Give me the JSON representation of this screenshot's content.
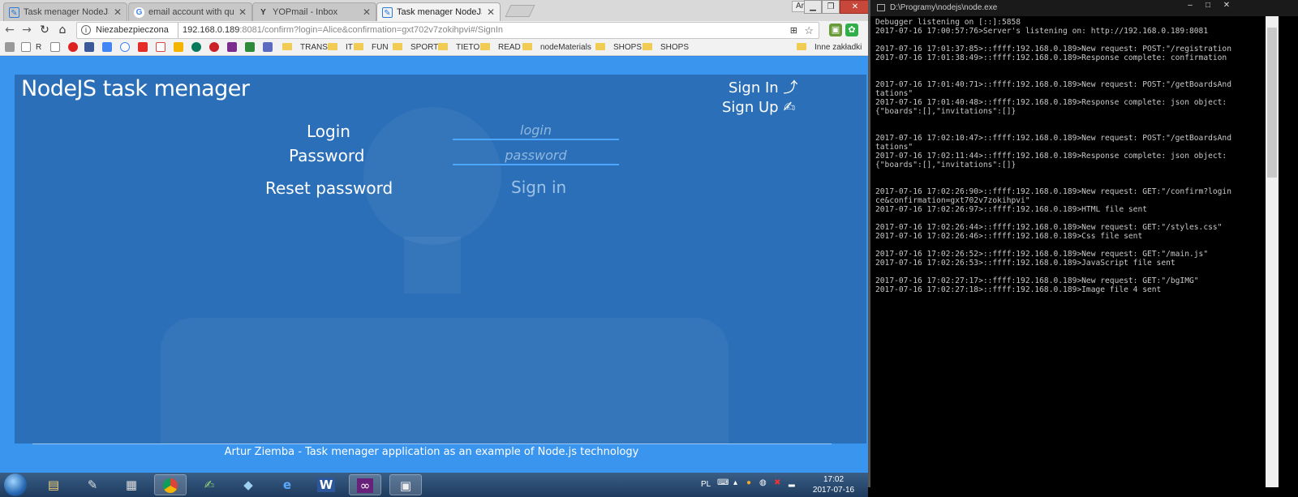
{
  "browser": {
    "tabs": [
      {
        "label": "Task menager NodeJS",
        "favicon": "task-icon",
        "active": false
      },
      {
        "label": "email account with quick",
        "favicon": "google-icon",
        "active": false
      },
      {
        "label": "YOPmail - Inbox",
        "favicon": "yopmail-icon",
        "active": false
      },
      {
        "label": "Task menager NodeJS",
        "favicon": "task-icon",
        "active": true
      }
    ],
    "user_chip": "Artur",
    "omnibox": {
      "security": "Niezabezpieczona",
      "host": "192.168.0.189",
      "path": ":8081/confirm?login=Alice&confirmation=gxt702v7zokihpvi#/SignIn"
    },
    "bookmarks": {
      "short": [
        "R"
      ],
      "folders": [
        "TRANS",
        "IT",
        "FUN",
        "SPORT",
        "TIETO",
        "READ",
        "nodeMaterials",
        "SHOPS",
        "SHOPS"
      ],
      "other": "Inne zakładki"
    }
  },
  "app": {
    "title": "NodeJS task menager",
    "nav": {
      "signin": "Sign In",
      "signup": "Sign Up"
    },
    "form": {
      "login_label": "Login",
      "login_placeholder": "login",
      "password_label": "Password",
      "password_placeholder": "password",
      "reset_label": "Reset password",
      "signin_button": "Sign in"
    },
    "footer": "Artur Ziemba - Task menager application as an example of Node.js technology"
  },
  "console": {
    "title": "D:\\Programy\\nodejs\\node.exe",
    "lines": [
      "Debugger listening on [::]:5858",
      "2017-07-16 17:00:57:76>Server's listening on: http://192.168.0.189:8081",
      "",
      "2017-07-16 17:01:37:85>::ffff:192.168.0.189>New request: POST:\"/registration",
      "2017-07-16 17:01:38:49>::ffff:192.168.0.189>Response complete: confirmation",
      "",
      "",
      "2017-07-16 17:01:40:71>::ffff:192.168.0.189>New request: POST:\"/getBoardsAnd",
      "tations\"",
      "2017-07-16 17:01:40:48>::ffff:192.168.0.189>Response complete: json object:",
      "{\"boards\":[],\"invitations\":[]}",
      "",
      "",
      "2017-07-16 17:02:10:47>::ffff:192.168.0.189>New request: POST:\"/getBoardsAnd",
      "tations\"",
      "2017-07-16 17:02:11:44>::ffff:192.168.0.189>Response complete: json object:",
      "{\"boards\":[],\"invitations\":[]}",
      "",
      "",
      "2017-07-16 17:02:26:90>::ffff:192.168.0.189>New request: GET:\"/confirm?login",
      "ce&confirmation=gxt702v7zokihpvi\"",
      "2017-07-16 17:02:26:97>::ffff:192.168.0.189>HTML file sent",
      "",
      "2017-07-16 17:02:26:44>::ffff:192.168.0.189>New request: GET:\"/styles.css\"",
      "2017-07-16 17:02:26:46>::ffff:192.168.0.189>Css file sent",
      "",
      "2017-07-16 17:02:26:52>::ffff:192.168.0.189>New request: GET:\"/main.js\"",
      "2017-07-16 17:02:26:53>::ffff:192.168.0.189>JavaScript file sent",
      "",
      "2017-07-16 17:02:27:17>::ffff:192.168.0.189>New request: GET:\"/bgIMG\"",
      "2017-07-16 17:02:27:18>::ffff:192.168.0.189>Image file 4 sent"
    ]
  },
  "taskbar": {
    "language": "PL",
    "time": "17:02",
    "date": "2017-07-16"
  },
  "colors": {
    "page_bg": "#3a95ee",
    "panel_bg": "#2b6fb8",
    "field_underline": "#4aa6ff",
    "console_bg": "#000000"
  }
}
